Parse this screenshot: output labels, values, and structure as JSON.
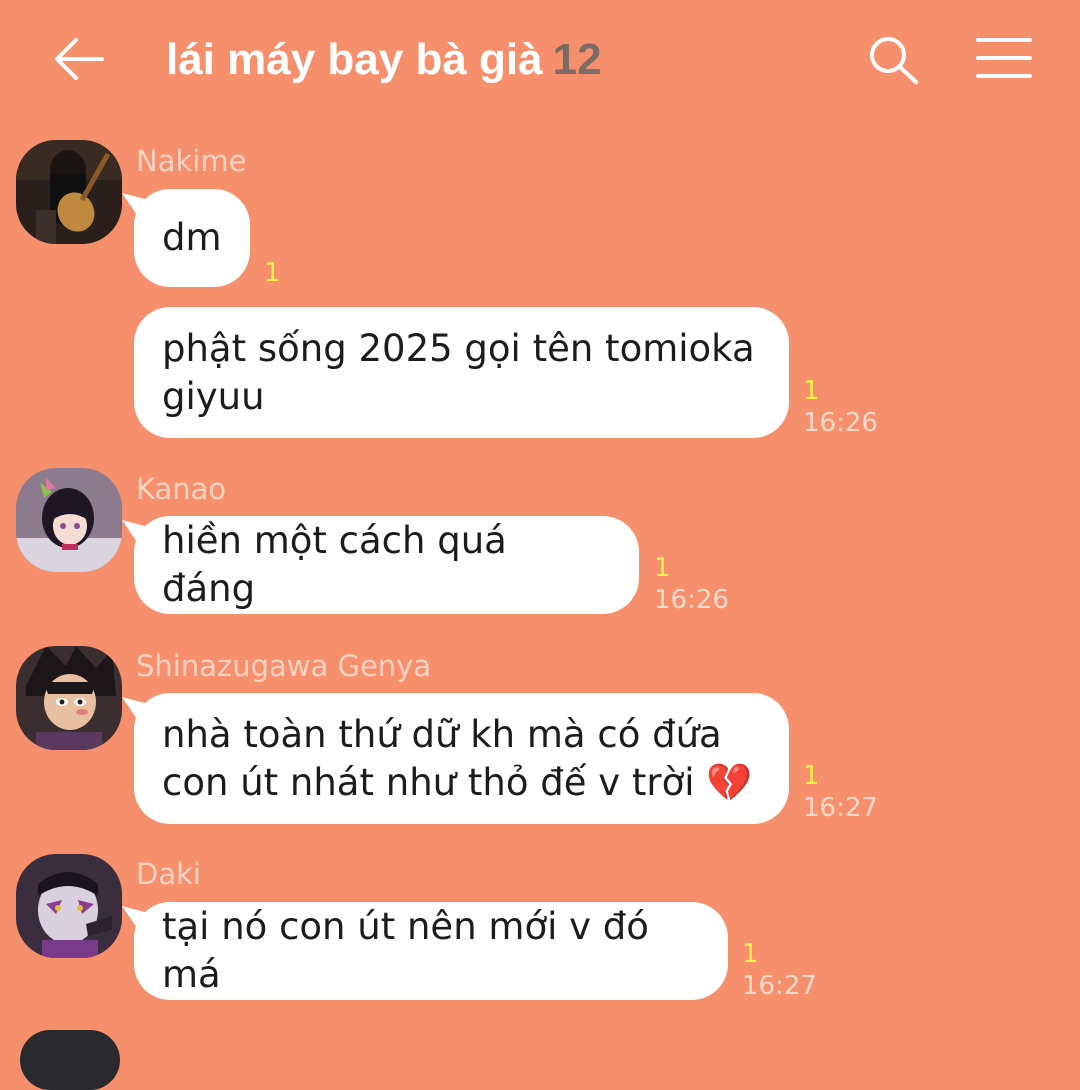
{
  "header": {
    "title": "lái máy bay bà già",
    "member_count": "12",
    "back_icon": "arrow-left-icon",
    "search_icon": "search-icon",
    "menu_icon": "menu-icon"
  },
  "colors": {
    "background": "#F6906C",
    "bubble": "#FFFFFF",
    "read_count": "#FFF04A",
    "member_count": "#7A6B66"
  },
  "messages": [
    {
      "sender": "Nakime",
      "bubbles": [
        {
          "text": "dm",
          "read": "1",
          "time": ""
        },
        {
          "text": "phật sống 2025 gọi tên tomioka\ngiyuu",
          "read": "1",
          "time": "16:26"
        }
      ]
    },
    {
      "sender": "Kanao",
      "bubbles": [
        {
          "text": "hiền một cách quá đáng",
          "read": "1",
          "time": "16:26"
        }
      ]
    },
    {
      "sender": "Shinazugawa Genya",
      "bubbles": [
        {
          "text": "nhà toàn thứ dữ kh mà có đứa\ncon út nhát như thỏ đế v trời 💔",
          "read": "1",
          "time": "16:27"
        }
      ]
    },
    {
      "sender": "Daki",
      "bubbles": [
        {
          "text": "tại nó con út nên mới v đó má",
          "read": "1",
          "time": "16:27"
        }
      ]
    }
  ]
}
